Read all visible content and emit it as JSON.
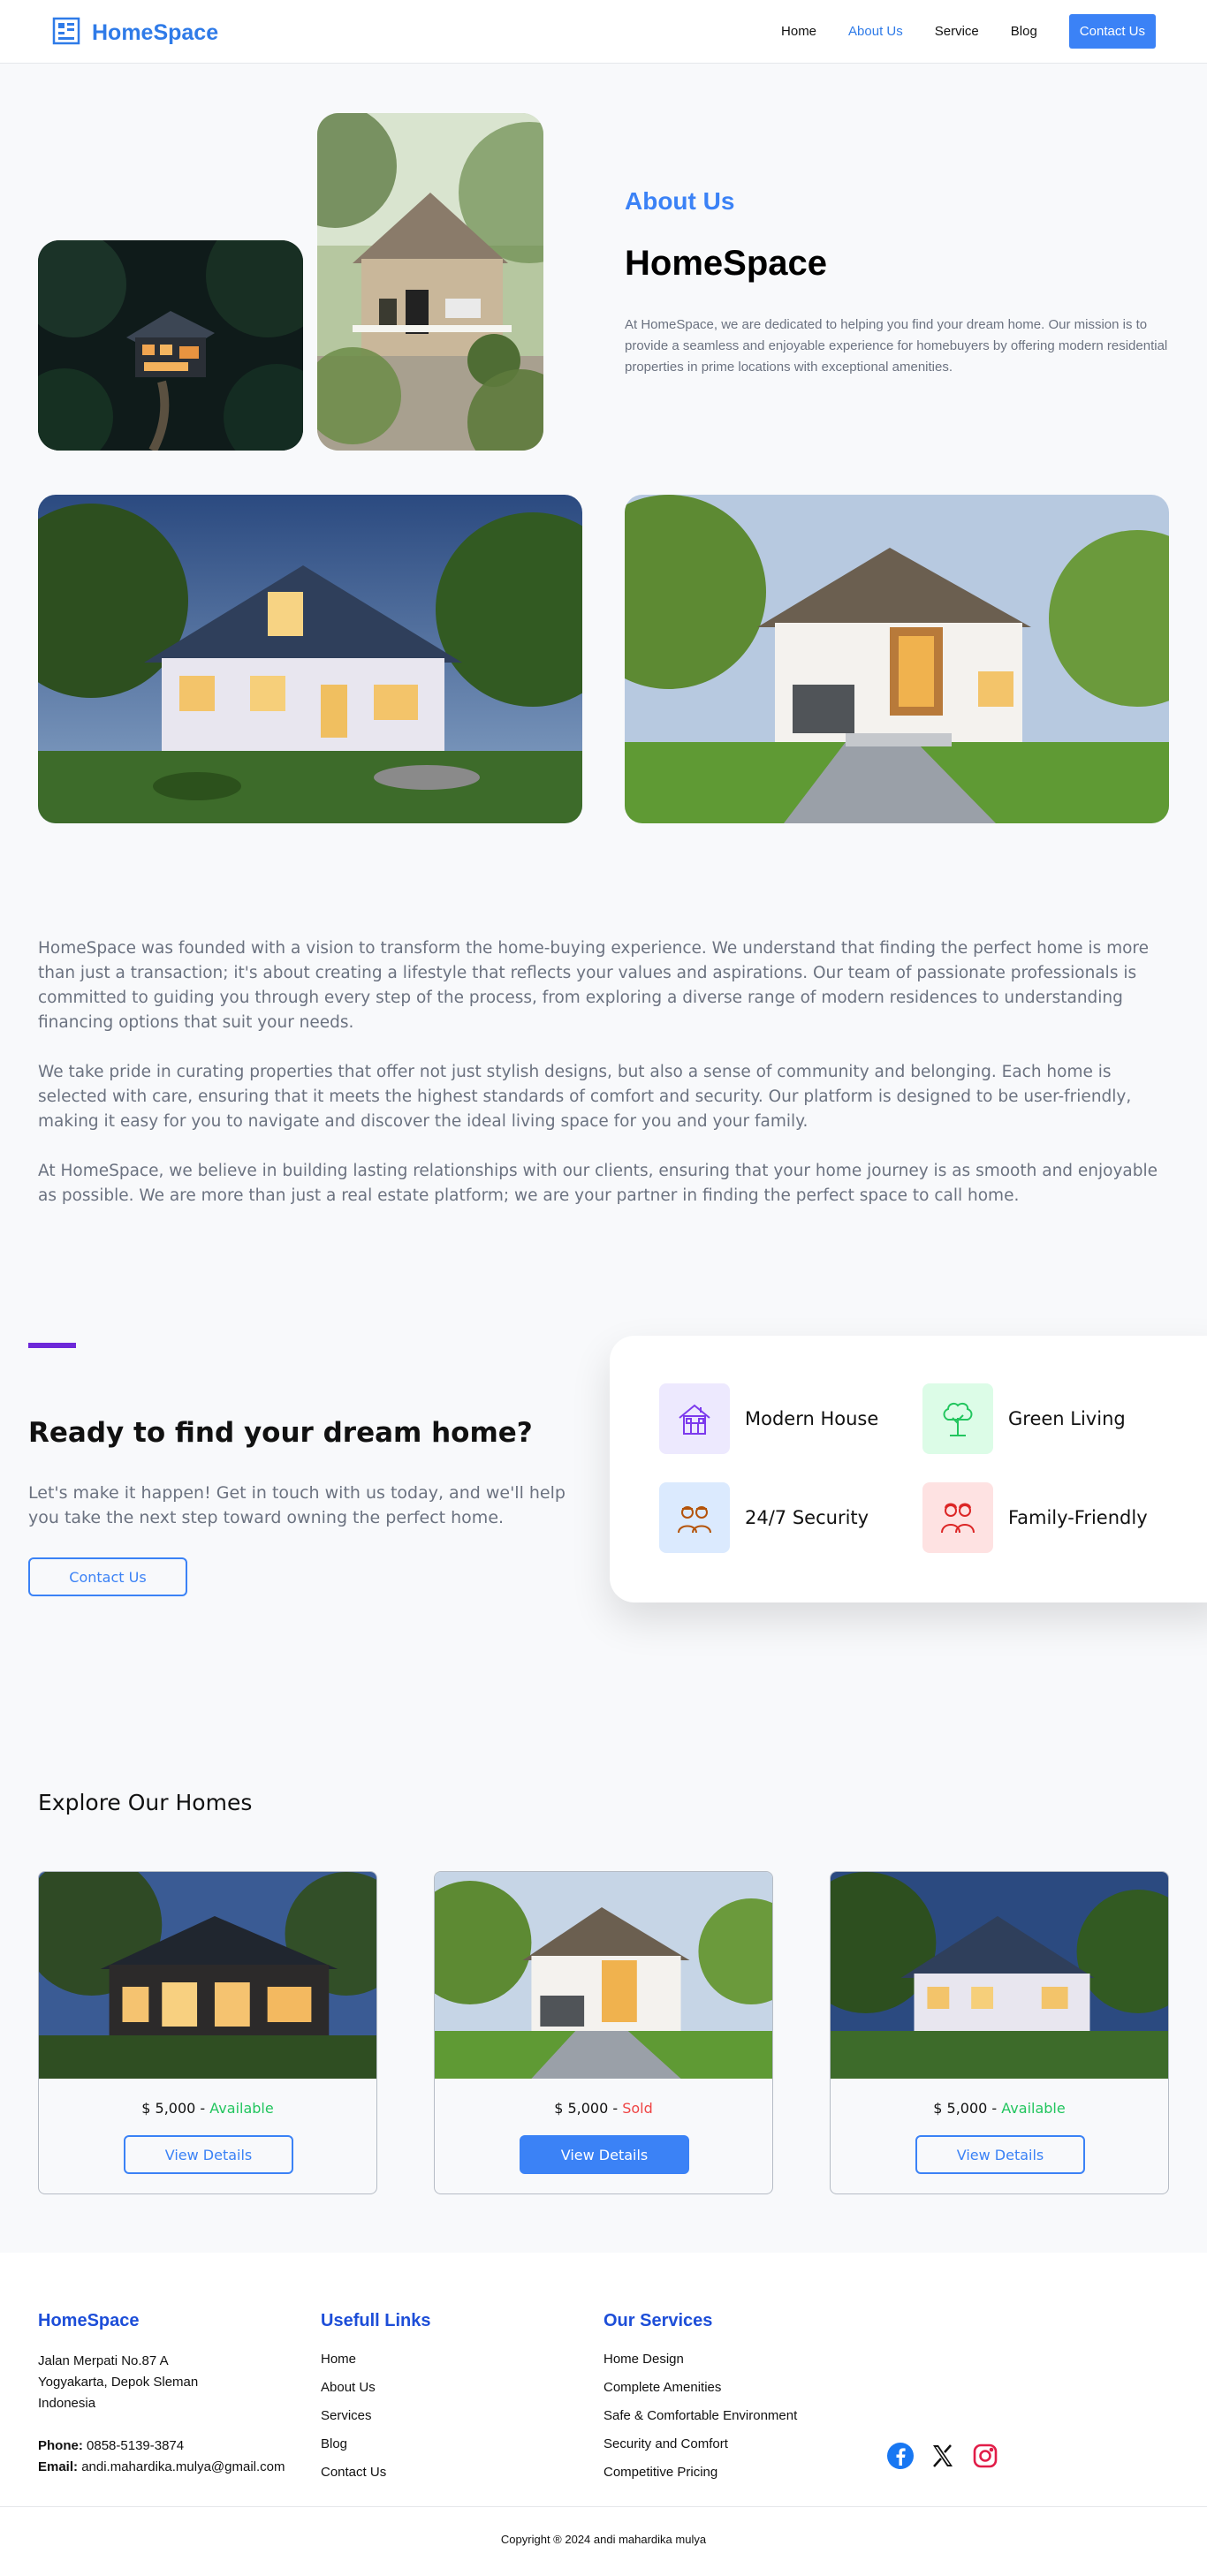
{
  "header": {
    "brand": "HomeSpace",
    "nav": [
      "Home",
      "About Us",
      "Service",
      "Blog"
    ],
    "contact_button": "Contact Us"
  },
  "about": {
    "label": "About Us",
    "title": "HomeSpace",
    "description": "At HomeSpace, we are dedicated to helping you find your dream home. Our mission is to provide a seamless and enjoyable experience for homebuyers by offering modern residential properties in prime locations with exceptional amenities."
  },
  "story": [
    "HomeSpace was founded with a vision to transform the home-buying experience. We understand that finding the perfect home is more than just a transaction; it's about creating a lifestyle that reflects your values and aspirations. Our team of passionate professionals is committed to guiding you through every step of the process, from exploring a diverse range of modern residences to understanding financing options that suit your needs.",
    "We take pride in curating properties that offer not just stylish designs, but also a sense of community and belonging. Each home is selected with care, ensuring that it meets the highest standards of comfort and security. Our platform is designed to be user-friendly, making it easy for you to navigate and discover the ideal living space for you and your family.",
    "At HomeSpace, we believe in building lasting relationships with our clients, ensuring that your home journey is as smooth and enjoyable as possible. We are more than just a real estate platform; we are your partner in finding the perfect space to call home."
  ],
  "cta": {
    "title": "Ready to find your dream home?",
    "text": "Let's make it happen! Get in touch with us today, and we'll help you take the next step toward owning the perfect home.",
    "button": "Contact Us"
  },
  "features": [
    {
      "label": "Modern House",
      "icon": "house-icon",
      "bg": "#ede9fe",
      "color": "#7c3aed"
    },
    {
      "label": "Green Living",
      "icon": "tree-icon",
      "bg": "#dcfce7",
      "color": "#22c55e"
    },
    {
      "label": "24/7 Security",
      "icon": "security-guard-icon",
      "bg": "#dbeafe",
      "color": "#b45309"
    },
    {
      "label": "Family-Friendly",
      "icon": "family-icon",
      "bg": "#fee2e2",
      "color": "#dc2626"
    }
  ],
  "explore": {
    "title": "Explore Our Homes",
    "cards": [
      {
        "price": "$ 5,000",
        "separator": " - ",
        "status": "Available",
        "button": "View Details"
      },
      {
        "price": "$ 5,000",
        "separator": " - ",
        "status": "Sold",
        "button": "View Details"
      },
      {
        "price": "$ 5,000",
        "separator": " - ",
        "status": "Available",
        "button": "View Details"
      }
    ]
  },
  "footer": {
    "brand": "HomeSpace",
    "address": [
      "Jalan Merpati No.87 A",
      "Yogyakarta, Depok Sleman",
      "Indonesia"
    ],
    "phone_label": "Phone:",
    "phone": "0858-5139-3874",
    "email_label": "Email:",
    "email": "andi.mahardika.mulya@gmail.com",
    "links_title": "Usefull Links",
    "links": [
      "Home",
      "About Us",
      "Services",
      "Blog",
      "Contact Us"
    ],
    "services_title": "Our Services",
    "services": [
      "Home Design",
      "Complete Amenities",
      "Safe & Comfortable Environment",
      "Security and Comfort",
      "Competitive Pricing"
    ],
    "social": [
      "facebook-icon",
      "x-icon",
      "instagram-icon"
    ],
    "copyright": "Copyright ® 2024 andi mahardika mulya"
  },
  "colors": {
    "brand": "#2f7be8",
    "accent_button": "#3b82f6",
    "available": "#22c55e",
    "sold": "#ef4444",
    "cta_bar": "#6d28d9"
  }
}
